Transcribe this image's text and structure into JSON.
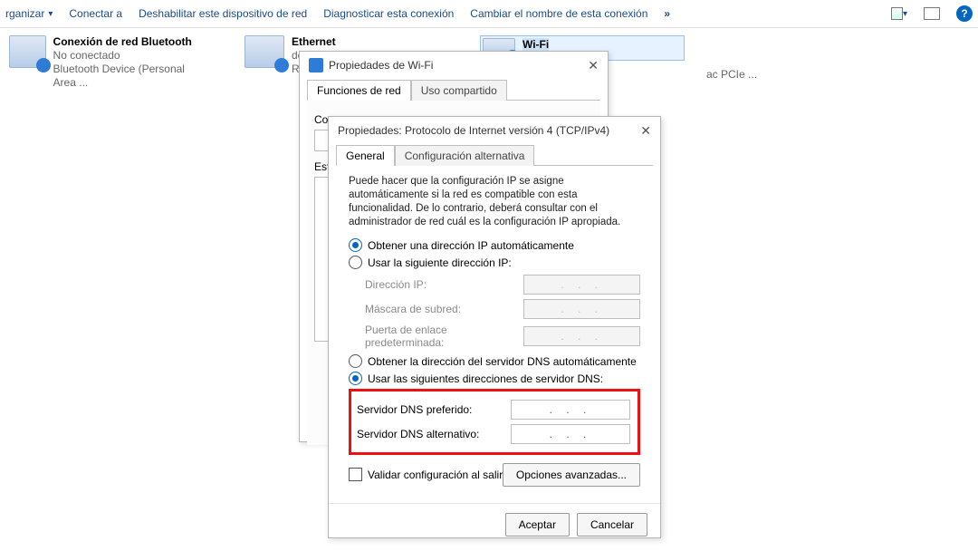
{
  "toolbar": {
    "organize": "rganizar",
    "connect": "Conectar a",
    "disable": "Deshabilitar este dispositivo de red",
    "diagnose": "Diagnosticar esta conexión",
    "rename": "Cambiar el nombre de esta conexión",
    "overflow": "»"
  },
  "adapters": {
    "bluetooth": {
      "name": "Conexión de red Bluetooth",
      "status": "No conectado",
      "device": "Bluetooth Device (Personal Area ..."
    },
    "ethernet": {
      "name": "Ethernet",
      "status": "devo",
      "device": "Realt"
    },
    "wifi": {
      "name": "Wi-Fi",
      "status": "",
      "device": "ac PCIe ..."
    }
  },
  "dlg1": {
    "title": "Propiedades de Wi-Fi",
    "tab1": "Funciones de red",
    "tab2": "Uso compartido",
    "connect_using": "Conectar con:",
    "this_connection": "Est"
  },
  "dlg2": {
    "title": "Propiedades: Protocolo de Internet versión 4 (TCP/IPv4)",
    "tab1": "General",
    "tab2": "Configuración alternativa",
    "intro": "Puede hacer que la configuración IP se asigne automáticamente si la red es compatible con esta funcionalidad. De lo contrario, deberá consultar con el administrador de red cuál es la configuración IP apropiada.",
    "ip_auto": "Obtener una dirección IP automáticamente",
    "ip_manual": "Usar la siguiente dirección IP:",
    "ip_addr": "Dirección IP:",
    "subnet": "Máscara de subred:",
    "gateway": "Puerta de enlace predeterminada:",
    "dns_auto": "Obtener la dirección del servidor DNS automáticamente",
    "dns_manual": "Usar las siguientes direcciones de servidor DNS:",
    "dns_pref": "Servidor DNS preferido:",
    "dns_alt": "Servidor DNS alternativo:",
    "ip_placeholder": ".   .   .",
    "validate": "Validar configuración al salir",
    "advanced": "Opciones avanzadas...",
    "ok": "Aceptar",
    "cancel": "Cancelar"
  }
}
